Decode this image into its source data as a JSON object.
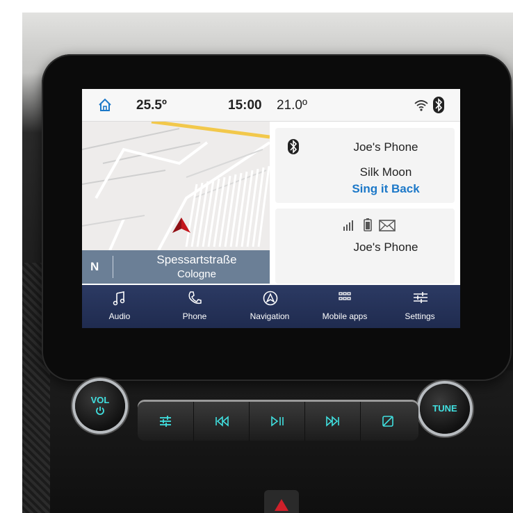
{
  "status_bar": {
    "temp_left": "25.5º",
    "time": "15:00",
    "temp_right": "21.0º",
    "icons": [
      "home-icon",
      "wifi-icon",
      "bluetooth-icon"
    ]
  },
  "map": {
    "direction": "N",
    "street": "Spessartstraße",
    "city": "Cologne"
  },
  "media_card": {
    "device": "Joe's Phone",
    "track": "Silk Moon",
    "artist": "Sing it Back"
  },
  "phone_status": {
    "device": "Joe's Phone",
    "icons": [
      "signal-icon",
      "battery-icon",
      "message-icon"
    ]
  },
  "nav": {
    "items": [
      {
        "label": "Audio",
        "icon": "music-note-icon"
      },
      {
        "label": "Phone",
        "icon": "phone-icon"
      },
      {
        "label": "Navigation",
        "icon": "navigation-icon"
      },
      {
        "label": "Mobile apps",
        "icon": "apps-grid-icon"
      },
      {
        "label": "Settings",
        "icon": "settings-sliders-icon"
      }
    ]
  },
  "controls": {
    "vol_label": "VOL",
    "tune_label": "TUNE",
    "accent": "#40e0e0"
  },
  "colors": {
    "accent_blue": "#1c78c8",
    "nav_bg": "#2c3a63",
    "street_bar": "#6b7f96"
  }
}
